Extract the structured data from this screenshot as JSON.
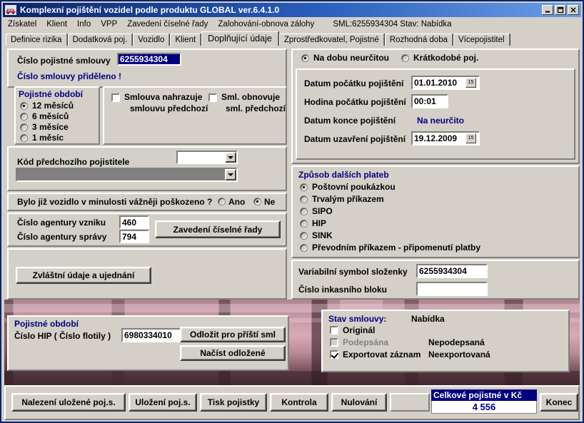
{
  "window": {
    "title": "Komplexní pojištění vozidel podle produktu GLOBAL ver.6.4.1.0",
    "icon": "car-icon",
    "minimize": "_",
    "maximize": "❐",
    "close": "✕"
  },
  "menubar": {
    "items": [
      {
        "label": "Získatel"
      },
      {
        "label": "Klient"
      },
      {
        "label": "Info"
      },
      {
        "label": "VPP"
      },
      {
        "label": "Zavedení číselné řady"
      },
      {
        "label": "Zalohování-obnova zálohy"
      }
    ],
    "status": "SML:6255934304 Stav: Nabídka"
  },
  "tabs": [
    {
      "label": "Definice rizika",
      "active": false
    },
    {
      "label": "Dodatková poj.",
      "active": false
    },
    {
      "label": "Vozidlo",
      "active": false
    },
    {
      "label": "Klient",
      "active": false
    },
    {
      "label": "Doplňující údaje",
      "active": true
    },
    {
      "label": "Zprostředkovatel, Pojistné",
      "active": false
    },
    {
      "label": "Rozhodná doba",
      "active": false
    },
    {
      "label": "Vícepojistitel",
      "active": false
    }
  ],
  "contract": {
    "number_label": "Číslo pojistné smlouvy",
    "number_value": "6255934304",
    "assigned_note": "Číslo smlouvy přiděleno !"
  },
  "period": {
    "legend": "Pojistné období",
    "options": [
      {
        "label": "12 měsíců",
        "selected": true
      },
      {
        "label": "6 měsíců",
        "selected": false
      },
      {
        "label": "3 měsíce",
        "selected": false
      },
      {
        "label": "1 měsíc",
        "selected": false
      }
    ]
  },
  "replacement": {
    "checkbox1_line1": "Smlouva nahrazuje",
    "checkbox1_line2": "smlouvu předchozí",
    "checkbox1_checked": false,
    "checkbox2_line1": "Sml. obnovuje",
    "checkbox2_line2": "sml. předchozí",
    "checkbox2_checked": false
  },
  "prev_insurer": {
    "label": "Kód předchozího pojistitele",
    "code_value": "",
    "name_value": ""
  },
  "damage": {
    "question": "Bylo již vozidlo v minulosti vážněji poškozeno ?",
    "yes_label": "Ano",
    "no_label": "Ne",
    "answer": "Ne"
  },
  "agency": {
    "origin_label": "Číslo agentury vzniku",
    "origin_value": "460",
    "admin_label": "Číslo agentury správy",
    "admin_value": "794",
    "series_button": "Zavedení číselné řady"
  },
  "special": {
    "button": "Zvláštní údaje a ujednání"
  },
  "duration": {
    "indefinite_label": "Na dobu neurčitou",
    "indefinite_selected": true,
    "shortterm_label": "Krátkodobé poj.",
    "shortterm_selected": false
  },
  "dates": {
    "start_label": "Datum počátku pojištění",
    "start_value": "01.01.2010",
    "hour_label": "Hodina počátku pojištění",
    "hour_value": "00:01",
    "end_label": "Datum konce pojištění",
    "end_value": "Na neurčito",
    "signed_label": "Datum uzavření pojištění",
    "signed_value": "19.12.2009",
    "calendar_icon": "15"
  },
  "payments": {
    "legend": "Způsob dalších plateb",
    "options": [
      {
        "label": "Poštovní poukázkou",
        "selected": true
      },
      {
        "label": "Trvalým příkazem",
        "selected": false
      },
      {
        "label": "SIPO",
        "selected": false
      },
      {
        "label": "HIP",
        "selected": false
      },
      {
        "label": "SINK",
        "selected": false
      },
      {
        "label": "Převodním příkazem - připomenutí platby",
        "selected": false
      }
    ],
    "vs_label": "Variabilní symbol složenky",
    "vs_value": "6255934304",
    "block_label": "Číslo inkasního bloku",
    "block_value": ""
  },
  "hip": {
    "legend": "Pojistné období",
    "label": "Číslo HIP ( Číslo flotily )",
    "value": "6980334010",
    "defer_button": "Odložit pro příští sml",
    "load_button": "Načíst odložené"
  },
  "status": {
    "legend": "Stav smlouvy:",
    "state": "Nabídka",
    "original_label": "Originál",
    "original_checked": false,
    "signed_label": "Podepsána",
    "signed_checked": false,
    "signed_status": "Nepodepsaná",
    "export_label": "Exportovat záznam",
    "export_checked": true,
    "export_status": "Neexportovaná"
  },
  "footer": {
    "buttons": [
      {
        "label": "Nalezení uložené poj.s."
      },
      {
        "label": "Uložení poj.s."
      },
      {
        "label": "Tisk pojistky"
      },
      {
        "label": "Kontrola"
      },
      {
        "label": "Nulování"
      }
    ],
    "total_label": "Celkové pojistné v Kč",
    "total_value": "4 556",
    "exit_button": "Konec"
  },
  "colors": {
    "accent": "#000080",
    "face": "#d4d0c8",
    "title_start": "#0a246a"
  }
}
